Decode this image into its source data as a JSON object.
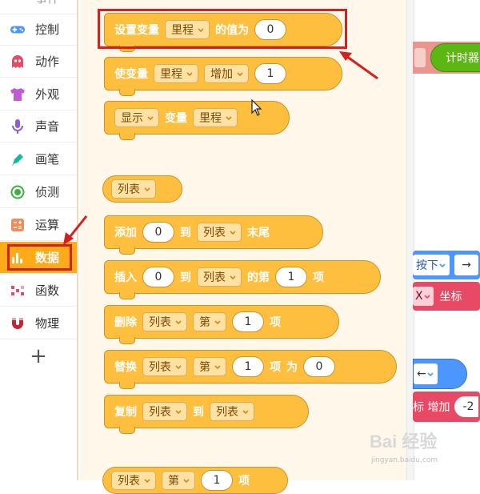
{
  "sidebar": {
    "items": [
      {
        "label": "控制",
        "icon": "gamepad-icon",
        "color": "#4c97ff"
      },
      {
        "label": "动作",
        "icon": "ghost-icon",
        "color": "#e84a65"
      },
      {
        "label": "外观",
        "icon": "shirt-icon",
        "color": "#c25ad6"
      },
      {
        "label": "声音",
        "icon": "microphone-icon",
        "color": "#8a5fd6"
      },
      {
        "label": "画笔",
        "icon": "pen-icon",
        "color": "#15b8a0"
      },
      {
        "label": "侦测",
        "icon": "target-icon",
        "color": "#3cb043"
      },
      {
        "label": "运算",
        "icon": "calculator-icon",
        "color": "#f08c5a"
      },
      {
        "label": "数据",
        "icon": "bar-chart-icon",
        "color": "#ffffff",
        "active": true
      },
      {
        "label": "函数",
        "icon": "function-icon",
        "color": "#e84a65"
      },
      {
        "label": "物理",
        "icon": "magnet-icon",
        "color": "#c02636"
      }
    ],
    "add_label": "+"
  },
  "blocks": {
    "set_var": {
      "w1": "设置变量",
      "dd": "里程",
      "w2": "的值为",
      "val": "0"
    },
    "change_var": {
      "w1": "使变量",
      "dd1": "里程",
      "dd2": "增加",
      "val": "1"
    },
    "show_var": {
      "dd1": "显示",
      "w1": "变量",
      "dd2": "里程"
    },
    "list_rep": {
      "dd": "列表"
    },
    "add_list": {
      "w1": "添加",
      "val": "0",
      "w2": "到",
      "dd": "列表",
      "w3": "末尾"
    },
    "insert_list": {
      "w1": "插入",
      "val": "0",
      "w2": "到",
      "dd": "列表",
      "w3": "的第",
      "val2": "1",
      "w4": "项"
    },
    "delete_list": {
      "w1": "删除",
      "dd1": "列表",
      "dd2": "第",
      "val": "1",
      "w2": "项"
    },
    "replace_list": {
      "w1": "替换",
      "dd1": "列表",
      "dd2": "第",
      "val": "1",
      "w2": "项",
      "w3": "为",
      "val2": "0"
    },
    "copy_list": {
      "w1": "复制",
      "dd1": "列表",
      "w2": "到",
      "dd2": "列表"
    },
    "bottom_partial": {
      "dd1": "列表",
      "dd2": "第",
      "val": "1",
      "w1": "项"
    }
  },
  "workspace": {
    "timer_label": "计时器",
    "key_label": "按下",
    "arrow_glyph": "→",
    "x_label": "X",
    "coord_label": "坐标",
    "left_arrow": "←",
    "incr_text": "标 增加",
    "incr_val": "-2"
  },
  "watermark": {
    "logo": "Bai 经验",
    "site": "jingyan.baidu.com"
  },
  "colors": {
    "data_block": "#ffbf3e",
    "data_border": "#cc9226",
    "active_category": "#ffab19",
    "highlight": "#d42020",
    "event_green": "#5cb712",
    "motion_blue": "#4c97ff",
    "looks_red": "#e84a65"
  }
}
